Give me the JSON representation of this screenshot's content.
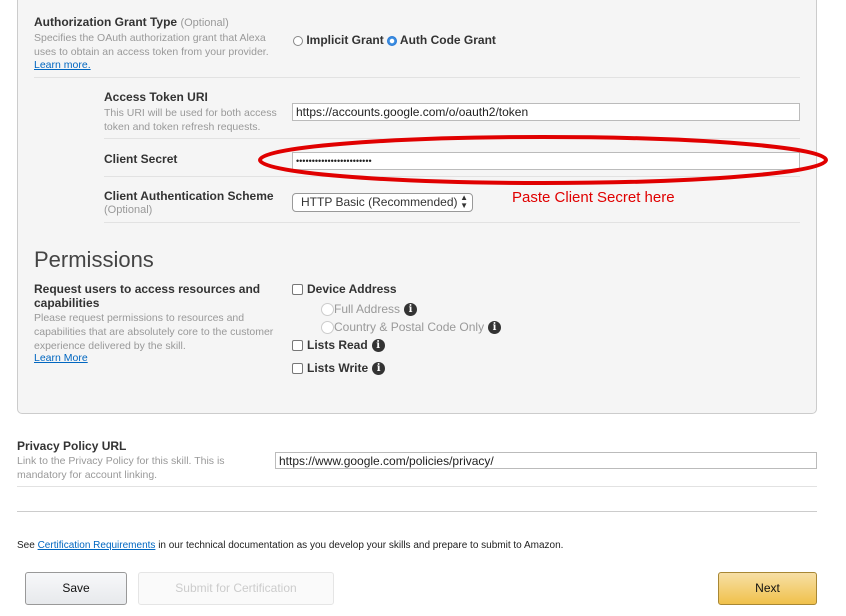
{
  "auth_grant": {
    "label": "Authorization Grant Type",
    "optional": "(Optional)",
    "description_1": "Specifies the OAuth authorization grant that Alexa",
    "description_2": "uses to obtain an access token from your provider.",
    "learn_more": "Learn more.",
    "options": [
      {
        "label": "Implicit Grant",
        "selected": false
      },
      {
        "label": "Auth Code Grant",
        "selected": true
      }
    ]
  },
  "access_token": {
    "label": "Access Token URI",
    "description_1": "This URI will be used for both access",
    "description_2": "token and token refresh requests.",
    "value": "https://accounts.google.com/o/oauth2/token"
  },
  "client_secret": {
    "label": "Client Secret",
    "value": "••••••••••••••••••••••••"
  },
  "auth_scheme": {
    "label": "Client Authentication Scheme",
    "optional": "(Optional)",
    "value": "HTTP Basic (Recommended)"
  },
  "annotation": {
    "text": "Paste Client Secret here",
    "color": "#e00000"
  },
  "permissions": {
    "title": "Permissions",
    "label_1": "Request users to access resources and",
    "label_2": "capabilities",
    "description_1": "Please request permissions to resources and",
    "description_2": "capabilities that are absolutely core to the customer",
    "description_3": "experience delivered by the skill.",
    "learn_more": "Learn More",
    "device_address": "Device Address",
    "full_address": "Full Address",
    "country_postal": "Country & Postal Code Only",
    "lists_read": "Lists Read",
    "lists_write": "Lists Write"
  },
  "privacy": {
    "label": "Privacy Policy URL",
    "description_1": "Link to the Privacy Policy for this skill. This is",
    "description_2": "mandatory for account linking.",
    "value": "https://www.google.com/policies/privacy/"
  },
  "footer": {
    "see": "See",
    "cert_link": "Certification Requirements",
    "rest": "in our technical documentation as you develop your skills and prepare to submit to Amazon.",
    "save": "Save",
    "submit": "Submit for Certification",
    "next": "Next"
  }
}
